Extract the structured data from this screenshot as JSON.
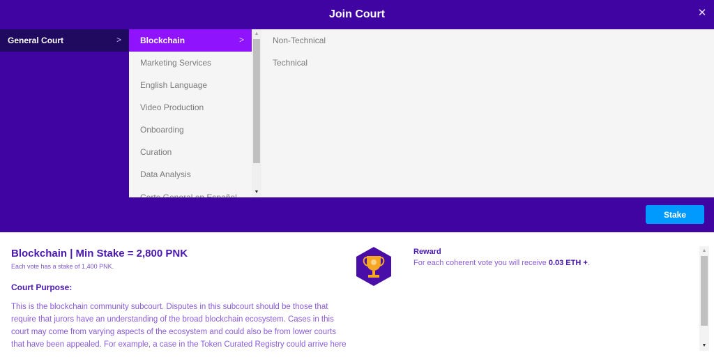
{
  "modal": {
    "title": "Join Court",
    "close_icon": "close-icon"
  },
  "cascader": {
    "level1": [
      {
        "label": "General Court",
        "selected": true
      }
    ],
    "level2": [
      {
        "label": "Blockchain",
        "selected": true
      },
      {
        "label": "Marketing Services"
      },
      {
        "label": "English Language"
      },
      {
        "label": "Video Production"
      },
      {
        "label": "Onboarding"
      },
      {
        "label": "Curation"
      },
      {
        "label": "Data Analysis"
      },
      {
        "label": "Corte General en Español"
      }
    ],
    "level3": [
      {
        "label": "Non-Technical"
      },
      {
        "label": "Technical"
      }
    ],
    "chevron": ">"
  },
  "stake_button": {
    "label": "Stake"
  },
  "details": {
    "title": "Blockchain | Min Stake = 2,800 PNK",
    "vote_stake": "Each vote has a stake of 1,400 PNK.",
    "purpose_label": "Court Purpose:",
    "purpose_text": "This is the blockchain community subcourt. Disputes in this subcourt should be those that require that jurors have an understanding of the broad blockchain ecosystem. Cases in this court may come from varying aspects of the ecosystem and could also be from lower courts that have been appealed. For example, a case in the Token Curated Registry could arrive here",
    "reward_label": "Reward",
    "reward_prefix": "For each coherent vote you will receive ",
    "reward_amount": "0.03 ETH +",
    "reward_suffix": ".",
    "reward_icon": "trophy-icon"
  },
  "colors": {
    "header_bg": "#4004a3",
    "selected_level1": "#1f0a5f",
    "selected_level2": "#9013fe",
    "stake_button": "#009aff",
    "title_text": "#4a18b0"
  }
}
